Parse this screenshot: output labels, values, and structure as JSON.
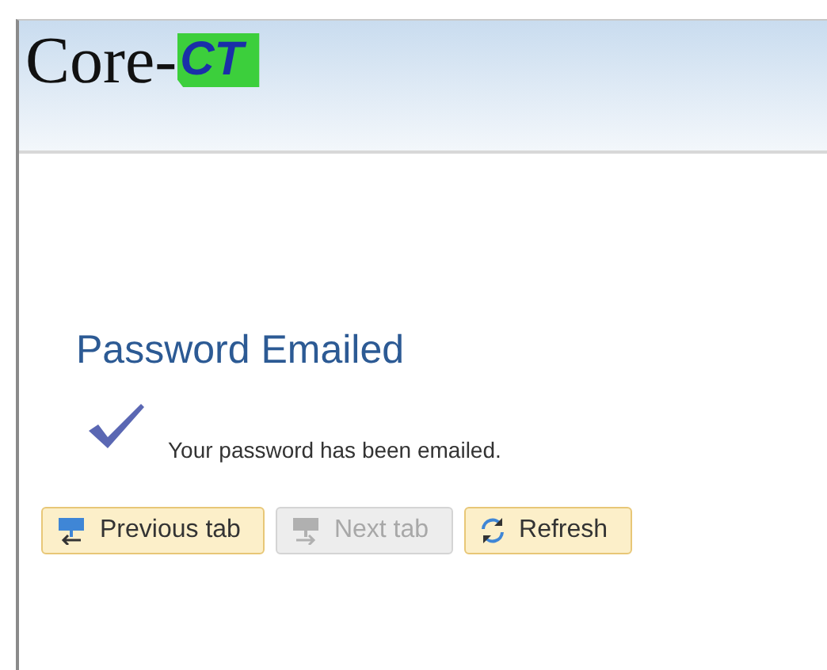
{
  "logo": {
    "text": "Core-",
    "badge": "CT"
  },
  "heading": "Password Emailed",
  "message": "Your password has been emailed.",
  "buttons": [
    {
      "label": "Previous tab",
      "kind": "previous",
      "disabled": false
    },
    {
      "label": "Next tab",
      "kind": "next",
      "disabled": true
    },
    {
      "label": "Refresh",
      "kind": "refresh",
      "disabled": false
    }
  ]
}
